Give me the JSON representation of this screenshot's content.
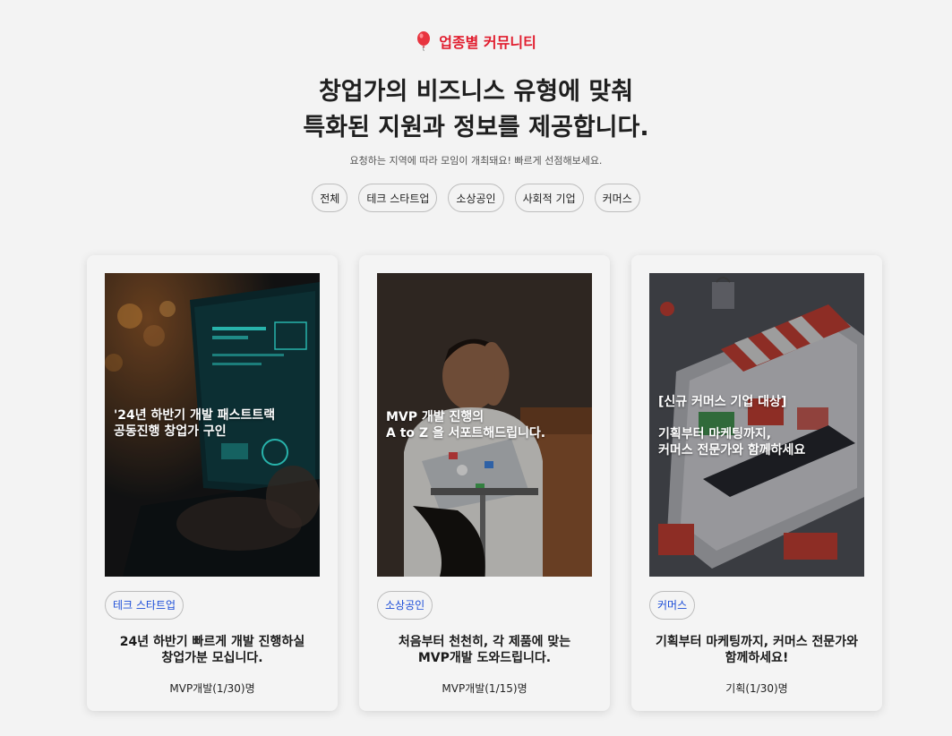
{
  "header": {
    "eyebrow": "업종별 커뮤니티",
    "eyebrow_color": "#e11d2e",
    "headline_line1": "창업가의 비즈니스 유형에 맞춰",
    "headline_line2": "특화된 지원과 정보를 제공합니다.",
    "subtext": "요청하는 지역에 따라 모임이 개최돼요! 빠르게 선점해보세요."
  },
  "filters": [
    "전체",
    "테크 스타트업",
    "소상공인",
    "사회적 기업",
    "커머스"
  ],
  "cards": [
    {
      "image_icon": "laptop-code-photo",
      "overlay": "'24년 하반기 개발 패스트트랙\n공동진행 창업가 구인",
      "tag": "테크 스타트업",
      "title": "24년 하반기 빠르게 개발 진행하실\n창업가분 모십니다.",
      "meta": "MVP개발(1/30)명"
    },
    {
      "image_icon": "stressed-developer-photo",
      "overlay": "MVP 개발 진행의\nA to Z 을 서포트해드립니다.",
      "tag": "소상공인",
      "title": "처음부터 천천히, 각 제품에 맞는\nMVP개발 도와드립니다.",
      "meta": "MVP개발(1/15)명"
    },
    {
      "image_icon": "ecommerce-illustration",
      "overlay": "[신규 커머스 기업 대상]\n\n기획부터 마케팅까지,\n커머스 전문가와 함께하세요",
      "tag": "커머스",
      "title": "기획부터 마케팅까지, 커머스 전문가와\n함께하세요!",
      "meta": "기획(1/30)명"
    }
  ],
  "colors": {
    "accent": "#e11d2e",
    "tag_text": "#1d4ed8"
  }
}
